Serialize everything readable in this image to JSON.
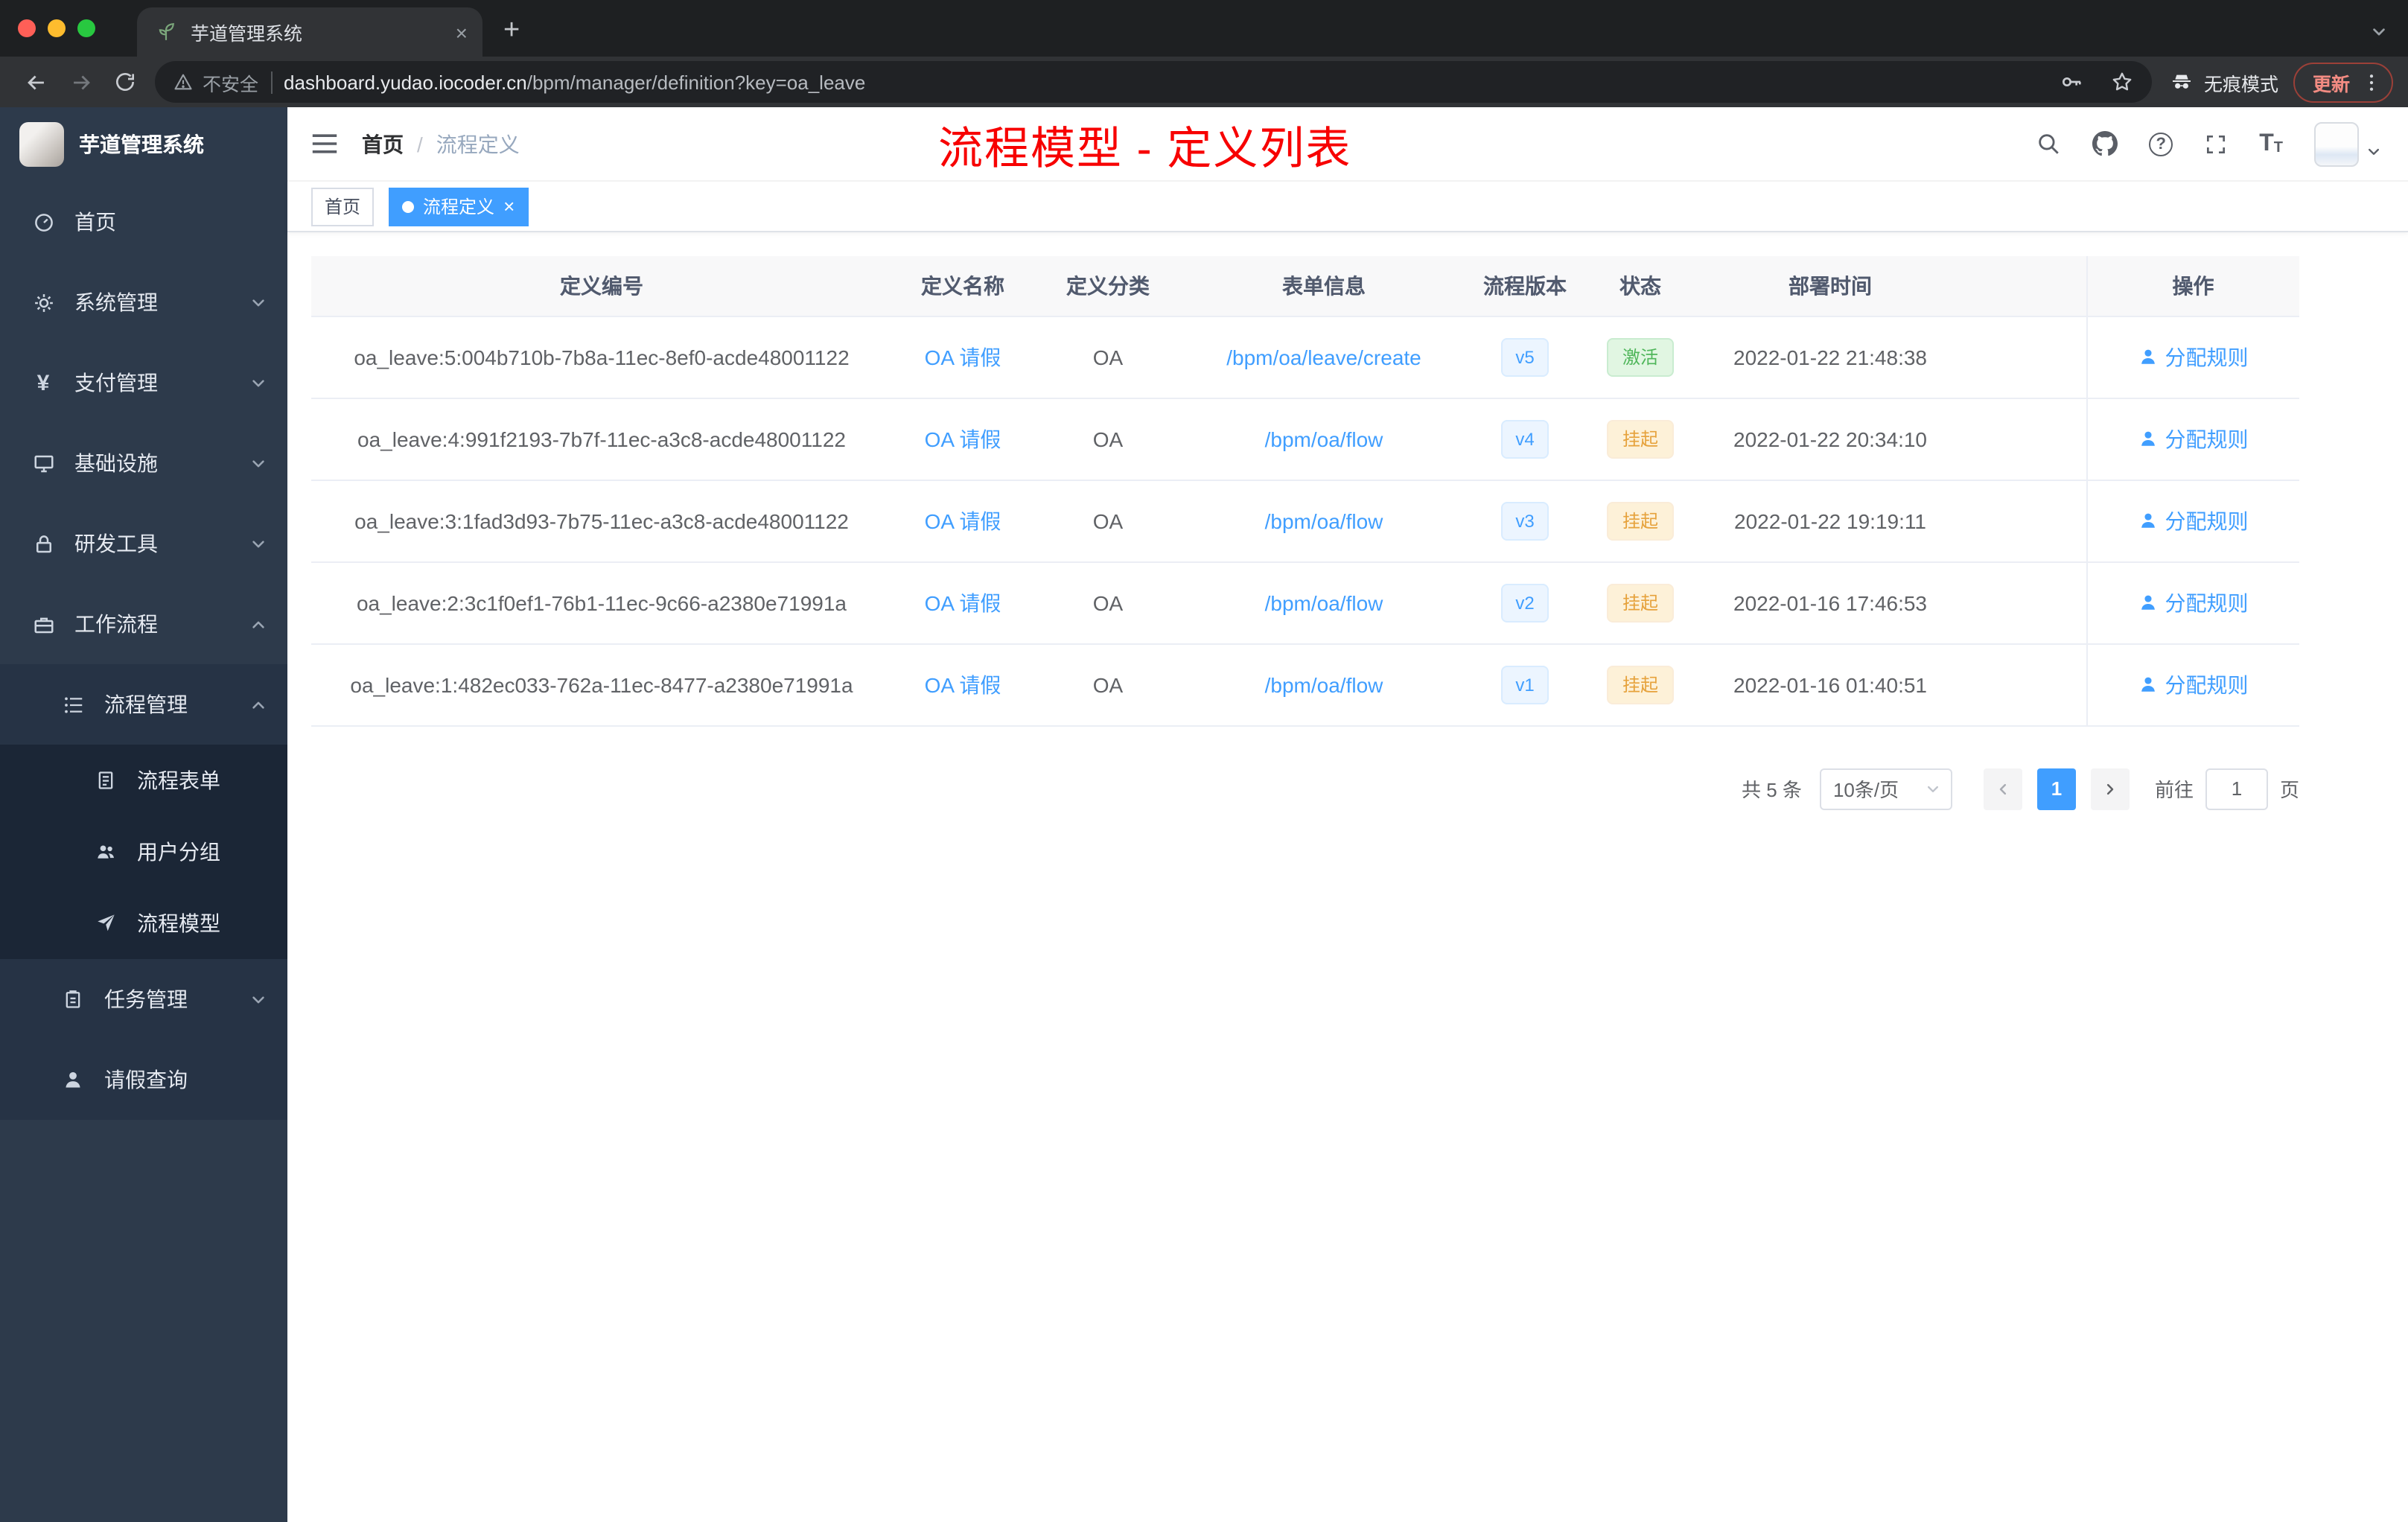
{
  "browser": {
    "tab_title": "芋道管理系统",
    "security_label": "不安全",
    "url_domain": "dashboard.yudao.iocoder.cn",
    "url_path": "/bpm/manager/definition?key=oa_leave",
    "incognito_label": "无痕模式",
    "update_label": "更新"
  },
  "sidebar": {
    "app_title": "芋道管理系统",
    "items": [
      {
        "label": "首页",
        "icon": "dashboard-icon",
        "level": 1
      },
      {
        "label": "系统管理",
        "icon": "gear-icon",
        "level": 1,
        "state": "collapsed"
      },
      {
        "label": "支付管理",
        "icon": "yen-icon",
        "level": 1,
        "state": "collapsed"
      },
      {
        "label": "基础设施",
        "icon": "monitor-icon",
        "level": 1,
        "state": "collapsed"
      },
      {
        "label": "研发工具",
        "icon": "lock-icon",
        "level": 1,
        "state": "collapsed"
      },
      {
        "label": "工作流程",
        "icon": "briefcase-icon",
        "level": 1,
        "state": "expanded"
      },
      {
        "label": "流程管理",
        "icon": "list-icon",
        "level": 2,
        "state": "expanded"
      },
      {
        "label": "流程表单",
        "icon": "document-icon",
        "level": 3
      },
      {
        "label": "用户分组",
        "icon": "users-icon",
        "level": 3
      },
      {
        "label": "流程模型",
        "icon": "paper-plane-icon",
        "level": 3
      },
      {
        "label": "任务管理",
        "icon": "clipboard-icon",
        "level": 2,
        "state": "collapsed"
      },
      {
        "label": "请假查询",
        "icon": "user-icon",
        "level": 2
      }
    ]
  },
  "header": {
    "breadcrumb": [
      "首页",
      "流程定义"
    ],
    "annotation": "流程模型 - 定义列表"
  },
  "tags": [
    {
      "label": "首页",
      "active": false
    },
    {
      "label": "流程定义",
      "active": true
    }
  ],
  "table": {
    "columns": [
      "定义编号",
      "定义名称",
      "定义分类",
      "表单信息",
      "流程版本",
      "状态",
      "部署时间",
      "操作"
    ],
    "action_label": "分配规则",
    "rows": [
      {
        "id": "oa_leave:5:004b710b-7b8a-11ec-8ef0-acde48001122",
        "name": "OA 请假",
        "category": "OA",
        "form": "/bpm/oa/leave/create",
        "version": "v5",
        "status": "激活",
        "status_type": "success",
        "deployed": "2022-01-22 21:48:38"
      },
      {
        "id": "oa_leave:4:991f2193-7b7f-11ec-a3c8-acde48001122",
        "name": "OA 请假",
        "category": "OA",
        "form": "/bpm/oa/flow",
        "version": "v4",
        "status": "挂起",
        "status_type": "warning",
        "deployed": "2022-01-22 20:34:10"
      },
      {
        "id": "oa_leave:3:1fad3d93-7b75-11ec-a3c8-acde48001122",
        "name": "OA 请假",
        "category": "OA",
        "form": "/bpm/oa/flow",
        "version": "v3",
        "status": "挂起",
        "status_type": "warning",
        "deployed": "2022-01-22 19:19:11"
      },
      {
        "id": "oa_leave:2:3c1f0ef1-76b1-11ec-9c66-a2380e71991a",
        "name": "OA 请假",
        "category": "OA",
        "form": "/bpm/oa/flow",
        "version": "v2",
        "status": "挂起",
        "status_type": "warning",
        "deployed": "2022-01-16 17:46:53"
      },
      {
        "id": "oa_leave:1:482ec033-762a-11ec-8477-a2380e71991a",
        "name": "OA 请假",
        "category": "OA",
        "form": "/bpm/oa/flow",
        "version": "v1",
        "status": "挂起",
        "status_type": "warning",
        "deployed": "2022-01-16 01:40:51"
      }
    ]
  },
  "pagination": {
    "total_label": "共 5 条",
    "page_size": "10条/页",
    "current_page": "1",
    "goto_label": "前往",
    "goto_value": "1",
    "unit_label": "页"
  },
  "colors": {
    "accent_blue": "#409eff",
    "success_green": "#67c23a",
    "warning_orange": "#e6a23c",
    "annotation_red": "#f70000",
    "sidebar_bg": "#2d3a4b"
  }
}
